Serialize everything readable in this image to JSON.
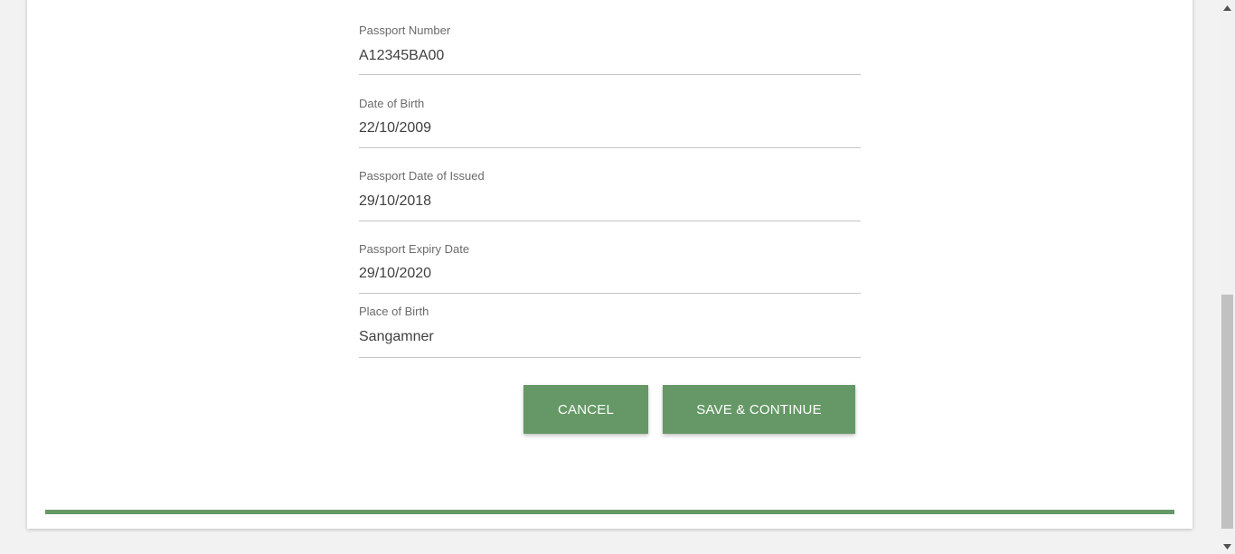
{
  "form": {
    "fields": [
      {
        "label": "Passport Number",
        "value": "A12345BA00"
      },
      {
        "label": "Date of Birth",
        "value": "22/10/2009"
      },
      {
        "label": "Passport Date of Issued",
        "value": "29/10/2018"
      },
      {
        "label": "Passport Expiry Date",
        "value": "29/10/2020"
      },
      {
        "label": "Place of Birth",
        "value": "Sangamner"
      }
    ]
  },
  "actions": {
    "cancel_label": "CANCEL",
    "save_label": "SAVE & CONTINUE"
  },
  "colors": {
    "accent": "#659866",
    "page_background": "#f2f2f2",
    "card_background": "#ffffff"
  },
  "icons": {
    "scroll_up": "triangle-up-icon",
    "scroll_down": "triangle-down-icon"
  }
}
